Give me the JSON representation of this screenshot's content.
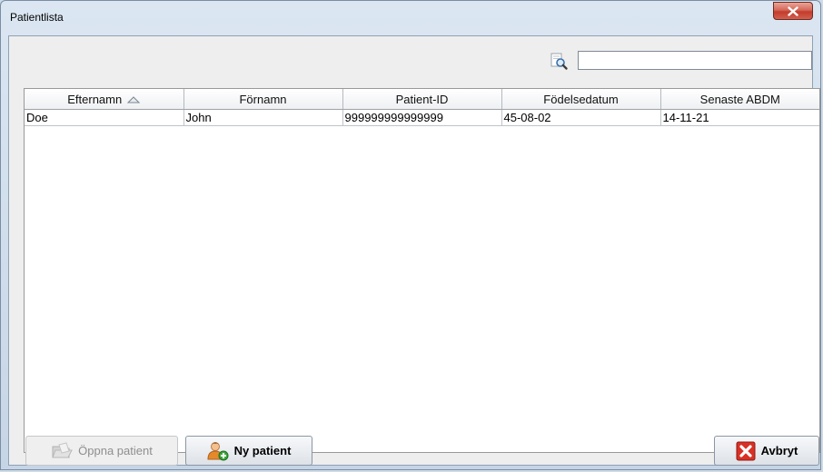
{
  "window": {
    "title": "Patientlista"
  },
  "search": {
    "value": "",
    "icon": "search-document-icon"
  },
  "table": {
    "columns": [
      "Efternamn",
      "Förnamn",
      "Patient-ID",
      "Födelsedatum",
      "Senaste ABDM"
    ],
    "sort_column": "Efternamn",
    "rows": [
      [
        "Doe",
        "John",
        "999999999999999",
        "45-08-02",
        "14-11-21"
      ]
    ]
  },
  "buttons": {
    "open_patient": "Öppna patient",
    "new_patient": "Ny patient",
    "cancel": "Avbryt"
  },
  "colors": {
    "close": "#c43b2a",
    "window_frame": "#cfdbe8"
  }
}
